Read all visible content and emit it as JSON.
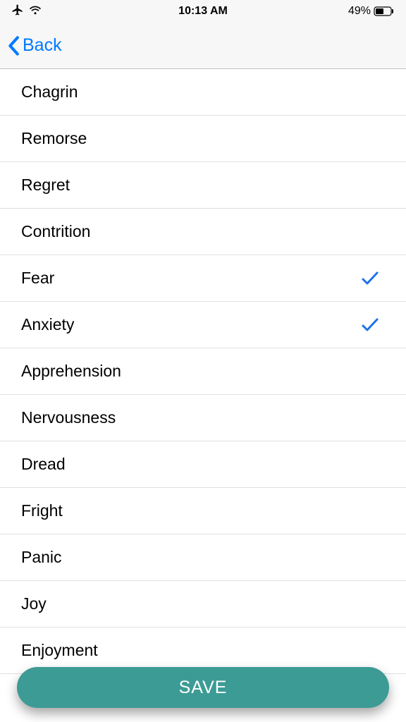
{
  "statusBar": {
    "time": "10:13 AM",
    "battery": "49%"
  },
  "nav": {
    "back": "Back"
  },
  "list": {
    "items": [
      {
        "label": "Chagrin",
        "checked": false
      },
      {
        "label": "Remorse",
        "checked": false
      },
      {
        "label": "Regret",
        "checked": false
      },
      {
        "label": "Contrition",
        "checked": false
      },
      {
        "label": "Fear",
        "checked": true
      },
      {
        "label": "Anxiety",
        "checked": true
      },
      {
        "label": "Apprehension",
        "checked": false
      },
      {
        "label": "Nervousness",
        "checked": false
      },
      {
        "label": "Dread",
        "checked": false
      },
      {
        "label": "Fright",
        "checked": false
      },
      {
        "label": "Panic",
        "checked": false
      },
      {
        "label": "Joy",
        "checked": false
      },
      {
        "label": "Enjoyment",
        "checked": false
      }
    ]
  },
  "actions": {
    "save": "SAVE"
  },
  "colors": {
    "accent": "#007aff",
    "saveButton": "#3d9b95"
  }
}
